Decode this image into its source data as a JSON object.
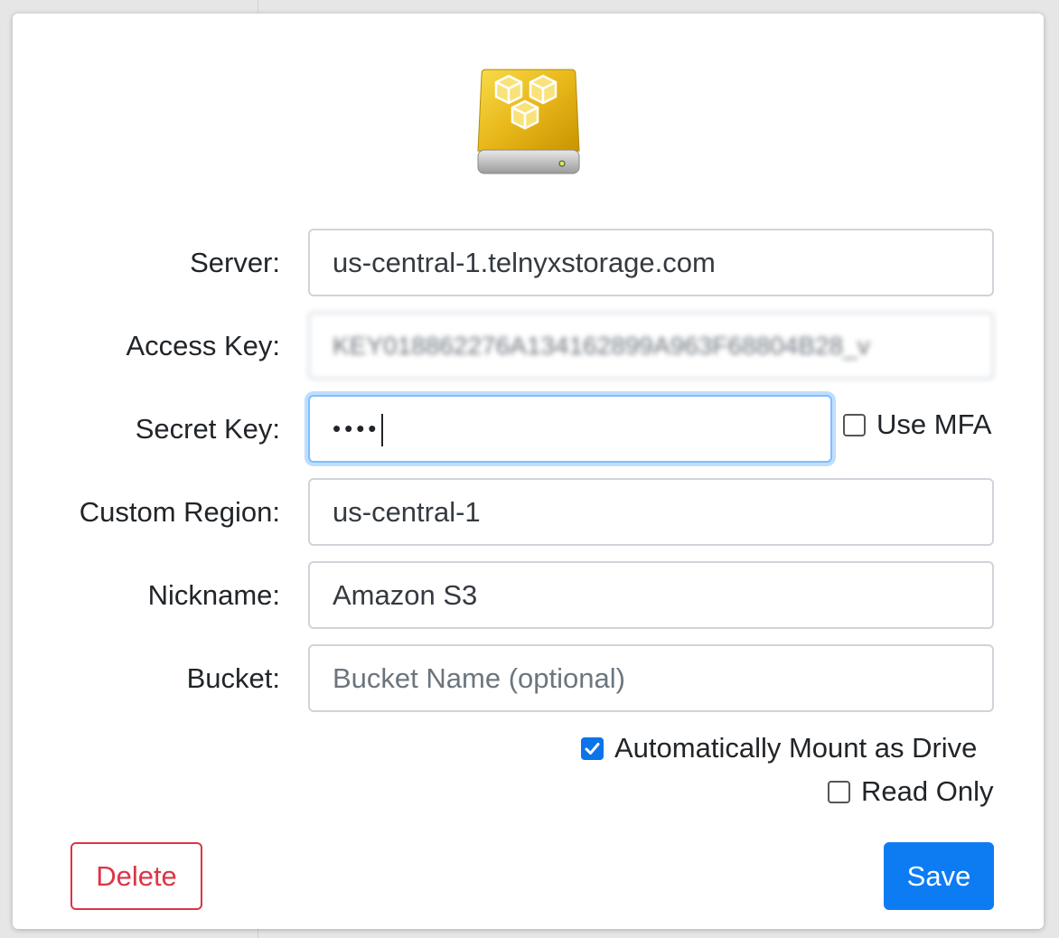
{
  "form": {
    "server": {
      "label": "Server:",
      "value": "us-central-1.telnyxstorage.com"
    },
    "access_key": {
      "label": "Access Key:",
      "value": "KEY018862276A134162899A963F68804B28_v"
    },
    "secret_key": {
      "label": "Secret Key:",
      "value": "••••"
    },
    "use_mfa": {
      "label": "Use MFA",
      "checked": false
    },
    "custom_region": {
      "label": "Custom Region:",
      "value": "us-central-1"
    },
    "nickname": {
      "label": "Nickname:",
      "value": "Amazon S3"
    },
    "bucket": {
      "label": "Bucket:",
      "placeholder": "Bucket Name (optional)"
    },
    "auto_mount": {
      "label": "Automatically Mount as Drive",
      "checked": true
    },
    "read_only": {
      "label": "Read Only",
      "checked": false
    }
  },
  "buttons": {
    "delete": "Delete",
    "save": "Save"
  },
  "icons": {
    "drive": "s3-drive-icon"
  },
  "colors": {
    "primary": "#0d7cf2",
    "danger": "#dc3545",
    "drive_gold": "#e8b71a"
  }
}
